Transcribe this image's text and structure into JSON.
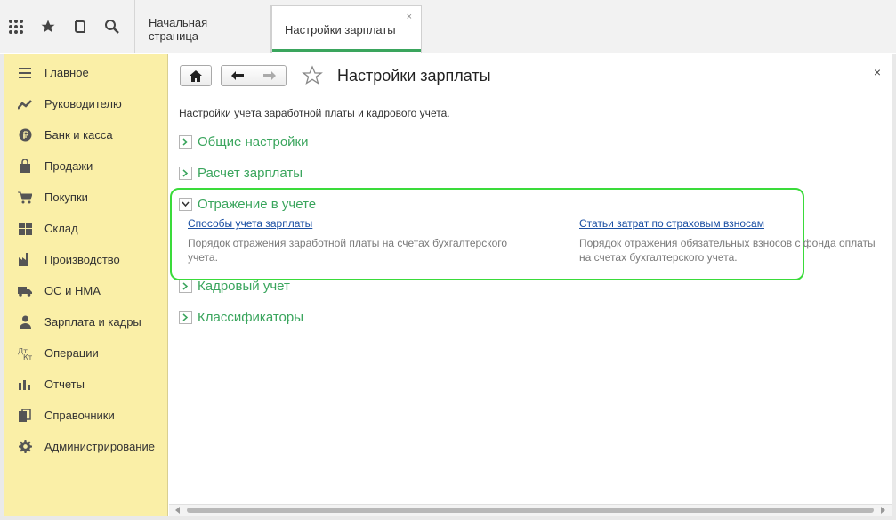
{
  "colors": {
    "accent": "#3aa55d",
    "sidebar_bg": "#faefa7",
    "link": "#1a4fa3",
    "highlight": "#3adb3a"
  },
  "toolbar": {
    "icons": [
      "apps-grid-icon",
      "favorites-star-icon",
      "history-icon",
      "search-icon"
    ]
  },
  "tabs": [
    {
      "label": "Начальная страница"
    },
    {
      "label": "Настройки зарплаты",
      "close": "×"
    }
  ],
  "sidebar": {
    "items": [
      {
        "label": "Главное",
        "icon": "menu-lines-icon"
      },
      {
        "label": "Руководителю",
        "icon": "trend-icon"
      },
      {
        "label": "Банк и касса",
        "icon": "ruble-icon"
      },
      {
        "label": "Продажи",
        "icon": "shopping-bag-icon"
      },
      {
        "label": "Покупки",
        "icon": "cart-icon"
      },
      {
        "label": "Склад",
        "icon": "warehouse-icon"
      },
      {
        "label": "Производство",
        "icon": "factory-icon"
      },
      {
        "label": "ОС и НМА",
        "icon": "truck-icon"
      },
      {
        "label": "Зарплата и кадры",
        "icon": "people-icon"
      },
      {
        "label": "Операции",
        "icon": "debit-credit-icon"
      },
      {
        "label": "Отчеты",
        "icon": "bar-chart-icon"
      },
      {
        "label": "Справочники",
        "icon": "books-icon"
      },
      {
        "label": "Администрирование",
        "icon": "gear-icon"
      }
    ]
  },
  "main": {
    "title": "Настройки зарплаты",
    "close": "×",
    "description": "Настройки учета заработной платы и кадрового учета.",
    "sections": [
      {
        "label": "Общие настройки",
        "expanded": false
      },
      {
        "label": "Расчет зарплаты",
        "expanded": false
      },
      {
        "label": "Отражение в учете",
        "expanded": true
      },
      {
        "label": "Кадровый учет",
        "expanded": false
      },
      {
        "label": "Классификаторы",
        "expanded": false
      }
    ],
    "reflection": {
      "link1": "Способы учета зарплаты",
      "desc1_line1": "Порядок отражения заработной платы на счетах бухгалтерского",
      "desc1_line2": "учета.",
      "link2": "Статьи затрат по страховым взносам",
      "desc2_line1": "Порядок отражения обязательных взносов с фонда оплаты",
      "desc2_line2": "на счетах бухгалтерского учета."
    }
  }
}
